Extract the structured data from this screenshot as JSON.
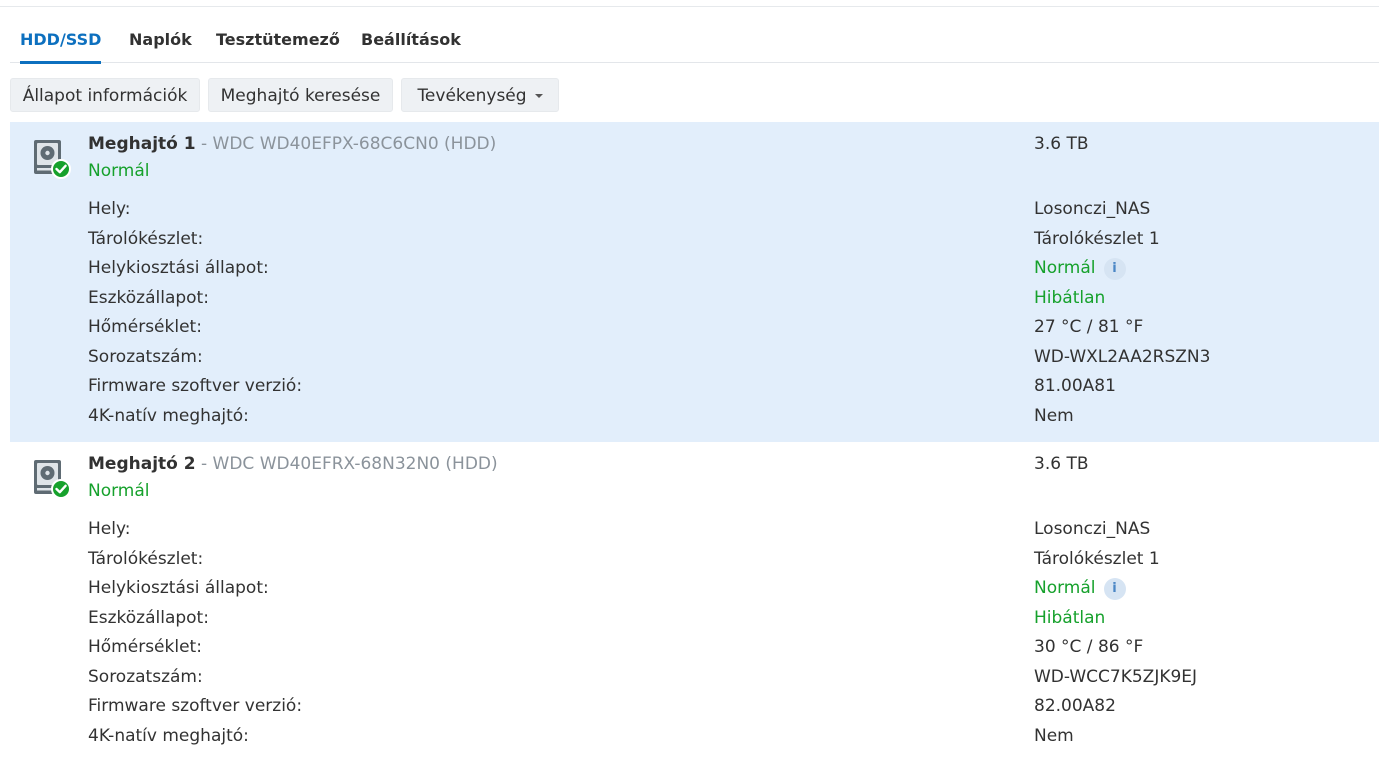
{
  "tabs": [
    {
      "label": "HDD/SSD",
      "active": true
    },
    {
      "label": "Naplók",
      "active": false
    },
    {
      "label": "Tesztütemező",
      "active": false
    },
    {
      "label": "Beállítások",
      "active": false
    }
  ],
  "toolbar": {
    "status_info_label": "Állapot információk",
    "search_drive_label": "Meghajtó keresése",
    "activity_label": "Tevékenység"
  },
  "colors": {
    "accent": "#0d70bf",
    "ok_green": "#16a12c",
    "selected_row": "#e2eefb"
  },
  "drives": [
    {
      "name": "Meghajtó 1",
      "model": " - WDC WD40EFPX-68C6CN0 (HDD)",
      "status": "Normál",
      "size": "3.6 TB",
      "icon": "hdd-ok-icon",
      "selected": true,
      "details": [
        {
          "label": "Hely:",
          "value": "Losonczi_NAS",
          "green": false,
          "info": false
        },
        {
          "label": "Tárolókészlet:",
          "value": "Tárolókészlet 1",
          "green": false,
          "info": false
        },
        {
          "label": "Helykiosztási állapot:",
          "value": "Normál",
          "green": true,
          "info": true
        },
        {
          "label": "Eszközállapot:",
          "value": "Hibátlan",
          "green": true,
          "info": false
        },
        {
          "label": "Hőmérséklet:",
          "value": "27 °C / 81 °F",
          "green": false,
          "info": false
        },
        {
          "label": "Sorozatszám:",
          "value": "WD-WXL2AA2RSZN3",
          "green": false,
          "info": false
        },
        {
          "label": "Firmware szoftver verzió:",
          "value": "81.00A81",
          "green": false,
          "info": false
        },
        {
          "label": "4K-natív meghajtó:",
          "value": "Nem",
          "green": false,
          "info": false
        }
      ]
    },
    {
      "name": "Meghajtó 2",
      "model": " - WDC WD40EFRX-68N32N0 (HDD)",
      "status": "Normál",
      "size": "3.6 TB",
      "icon": "hdd-ok-icon",
      "selected": false,
      "details": [
        {
          "label": "Hely:",
          "value": "Losonczi_NAS",
          "green": false,
          "info": false
        },
        {
          "label": "Tárolókészlet:",
          "value": "Tárolókészlet 1",
          "green": false,
          "info": false
        },
        {
          "label": "Helykiosztási állapot:",
          "value": "Normál",
          "green": true,
          "info": true
        },
        {
          "label": "Eszközállapot:",
          "value": "Hibátlan",
          "green": true,
          "info": false
        },
        {
          "label": "Hőmérséklet:",
          "value": "30 °C / 86 °F",
          "green": false,
          "info": false
        },
        {
          "label": "Sorozatszám:",
          "value": "WD-WCC7K5ZJK9EJ",
          "green": false,
          "info": false
        },
        {
          "label": "Firmware szoftver verzió:",
          "value": "82.00A82",
          "green": false,
          "info": false
        },
        {
          "label": "4K-natív meghajtó:",
          "value": "Nem",
          "green": false,
          "info": false
        }
      ]
    }
  ]
}
